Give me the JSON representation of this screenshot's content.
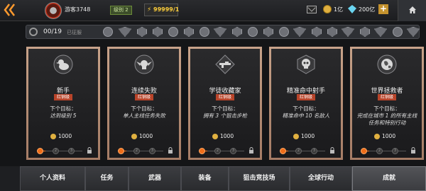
{
  "topbar": {
    "player_name": "游客3748",
    "level": "级别 2",
    "energy": "99999/1",
    "coins": "1亿",
    "diamonds": "200亿",
    "plus": "+"
  },
  "badge_strip": {
    "count": "00/19",
    "status": "已征服"
  },
  "cards": [
    {
      "title": "新手",
      "rank": "红铜级",
      "next_label": "下个目标：",
      "goal": "达到级别 5",
      "reward": "1000",
      "icon": "duck-icon",
      "progress": 0
    },
    {
      "title": "连续失败",
      "rank": "红铜级",
      "next_label": "下个目标：",
      "goal": "单人主线任务失败",
      "reward": "1000",
      "icon": "winged-skull-icon",
      "progress": 0
    },
    {
      "title": "学徒收藏家",
      "rank": "红铜级",
      "next_label": "下个目标：",
      "goal": "拥有 3 个狙击步枪",
      "reward": "1000",
      "icon": "rifle-icon",
      "progress": 0
    },
    {
      "title": "精准命中射手",
      "rank": "红铜级",
      "next_label": "下个目标：",
      "goal": "精准命中 10 名敌人",
      "reward": "1000",
      "icon": "skull-icon",
      "progress": 0
    },
    {
      "title": "世界拯救者",
      "rank": "红铜级",
      "next_label": "下个目标：",
      "goal": "完成在城市 1 的所有主线任务和特别行动",
      "reward": "1000",
      "icon": "globe-icon",
      "progress": 0
    }
  ],
  "tabs": [
    {
      "label": "个人资料",
      "active": false
    },
    {
      "label": "任务",
      "active": false
    },
    {
      "label": "武器",
      "active": false
    },
    {
      "label": "装备",
      "active": false
    },
    {
      "label": "狙击竞技场",
      "active": false
    },
    {
      "label": "全球行动",
      "active": false
    },
    {
      "label": "成就",
      "active": true
    }
  ],
  "colors": {
    "accent": "#f06e1a",
    "card_frame": "#b18a72",
    "rank_badge": "#b8442a"
  }
}
